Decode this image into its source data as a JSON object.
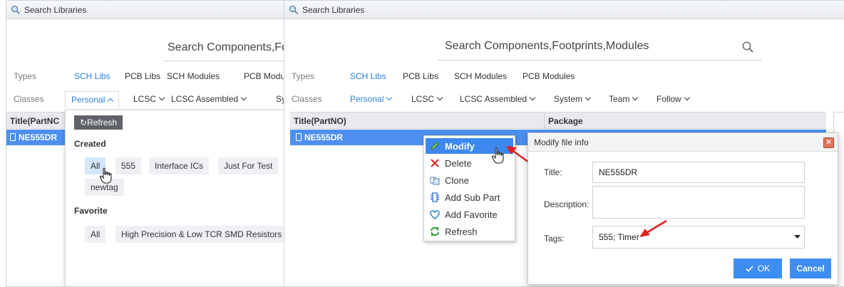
{
  "left_panel": {
    "title": "Search Libraries",
    "search_placeholder": "Search Components,Fo",
    "types_label": "Types",
    "types": [
      "SCH Libs",
      "PCB Libs",
      "SCH Modules",
      "PCB Modu"
    ],
    "classes_label": "Classes",
    "classes": [
      "Personal",
      "LCSC",
      "LCSC Assembled",
      "Sy"
    ],
    "table_header": "Title(PartNC",
    "selected_row": "NE555DR",
    "dropdown": {
      "refresh_label": "Refresh",
      "created_title": "Created",
      "created_tags": [
        "All",
        "555",
        "Interface ICs",
        "Just For Test",
        "newtag"
      ],
      "favorite_title": "Favorite",
      "favorite_tags": [
        "All",
        "High Precision & Low TCR SMD Resistors"
      ]
    }
  },
  "right_panel": {
    "title": "Search Libraries",
    "search_placeholder": "Search Components,Footprints,Modules",
    "types_label": "Types",
    "types": [
      "SCH Libs",
      "PCB Libs",
      "SCH Modules",
      "PCB Modules"
    ],
    "classes_label": "Classes",
    "classes": [
      "Personal",
      "LCSC",
      "LCSC Assembled",
      "System",
      "Team",
      "Follow"
    ],
    "col_title": "Title(PartNO)",
    "col_package": "Package",
    "selected_row": "NE555DR"
  },
  "context_menu": {
    "items": [
      {
        "label": "Modify",
        "icon": "pencil-icon"
      },
      {
        "label": "Delete",
        "icon": "delete-x-icon"
      },
      {
        "label": "Clone",
        "icon": "clone-icon"
      },
      {
        "label": "Add Sub Part",
        "icon": "sub-part-icon"
      },
      {
        "label": "Add Favorite",
        "icon": "heart-icon"
      },
      {
        "label": "Refresh",
        "icon": "refresh-icon"
      }
    ]
  },
  "dialog": {
    "title": "Modify file info",
    "title_label": "Title:",
    "title_value": "NE555DR",
    "description_label": "Description:",
    "description_value": "",
    "tags_label": "Tags:",
    "tags_value": "555; Timer",
    "ok_label": "OK",
    "cancel_label": "Cancel"
  },
  "colors": {
    "accent_blue": "#2b82d9",
    "selection_blue": "#4c8ff0",
    "arrow_red": "#e02020",
    "button_blue": "#3e8ef2"
  }
}
